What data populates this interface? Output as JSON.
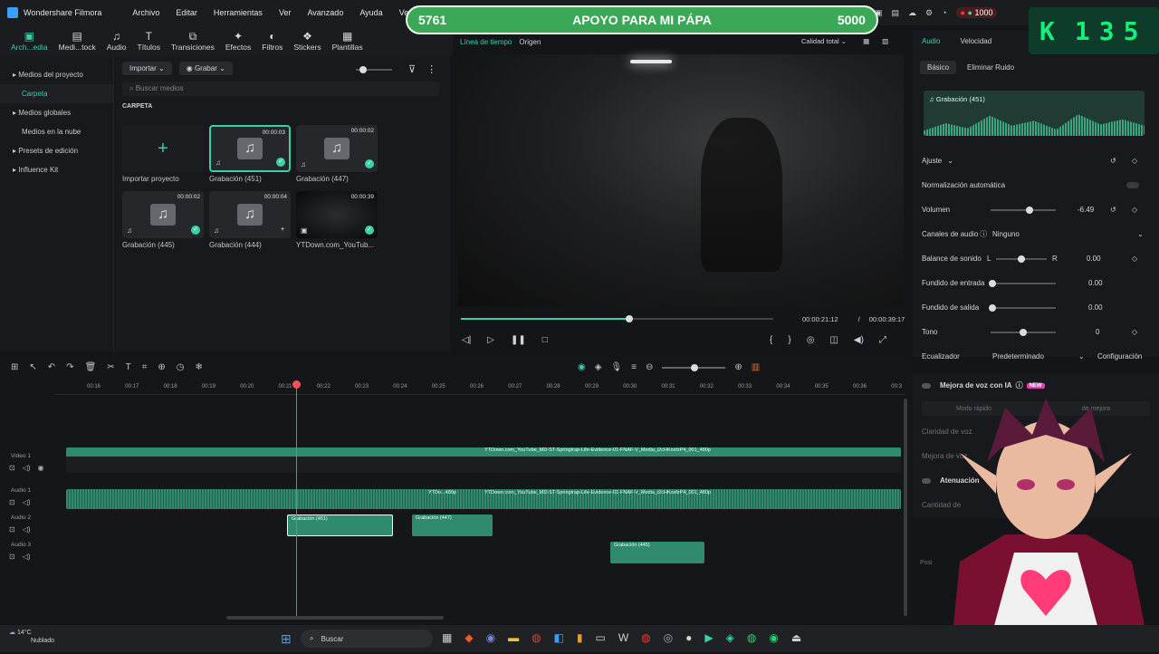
{
  "titlebar": {
    "app_name": "Wondershare Filmora",
    "menu": [
      "Archivo",
      "Editar",
      "Herramientas",
      "Ver",
      "Avanzado",
      "Ayuda",
      "Versión"
    ]
  },
  "toolbar": [
    {
      "label": "Arch...edia",
      "icon": "folder-icon",
      "active": true
    },
    {
      "label": "Medi...tock",
      "icon": "stock-icon"
    },
    {
      "label": "Audio",
      "icon": "music-icon"
    },
    {
      "label": "Títulos",
      "icon": "text-icon"
    },
    {
      "label": "Transiciones",
      "icon": "transition-icon"
    },
    {
      "label": "Efectos",
      "icon": "effects-icon"
    },
    {
      "label": "Filtros",
      "icon": "filter-icon"
    },
    {
      "label": "Stickers",
      "icon": "sticker-icon"
    },
    {
      "label": "Plantillas",
      "icon": "template-icon"
    }
  ],
  "leftnav": [
    {
      "label": "Medios del proyecto",
      "expandable": true
    },
    {
      "label": "Carpeta",
      "selected": true
    },
    {
      "label": "Medios globales",
      "expandable": true
    },
    {
      "label": "Medios en la nube"
    },
    {
      "label": "Presets de edición",
      "expandable": true
    },
    {
      "label": "Influence Kit",
      "expandable": true
    }
  ],
  "media": {
    "import_label": "Importar",
    "record_label": "Grabar",
    "search_placeholder": "Buscar medios",
    "folder_heading": "CARPETA",
    "items": [
      {
        "name": "Importar proyecto",
        "duration": "",
        "type": "import"
      },
      {
        "name": "Grabación (451)",
        "duration": "00:00:03",
        "type": "audio",
        "selected": true,
        "used": true
      },
      {
        "name": "Grabación (447)",
        "duration": "00:00:02",
        "type": "audio",
        "used": true
      },
      {
        "name": "Grabación (445)",
        "duration": "00:00:02",
        "type": "audio",
        "used": true
      },
      {
        "name": "Grabación (444)",
        "duration": "00:00:04",
        "type": "audio",
        "used": false
      },
      {
        "name": "YTDown.com_YouTub...",
        "duration": "00:00:39",
        "type": "video",
        "used": true
      }
    ]
  },
  "preview": {
    "tab_timeline": "Línea de tiempo",
    "tab_origin": "Origen",
    "quality": "Calidad total",
    "current_time": "00:00:21:12",
    "separator": "/",
    "total_time": "00:00:39:17",
    "progress": 0.54
  },
  "properties": {
    "tab_audio": "Audio",
    "tab_speed": "Velocidad",
    "sub_basic": "Básico",
    "sub_noise": "Eliminar Ruido",
    "waveform_title": "Grabación (451)",
    "adjust_label": "Ajuste",
    "auto_norm": "Normalización automática",
    "volume_label": "Volumen",
    "volume_value": "-6.49",
    "volume_level": 0.6,
    "channels_label": "Canales de audio",
    "channels_value": "Ninguno",
    "balance_label": "Balance de sonido",
    "balance_l": "L",
    "balance_r": "R",
    "balance_value": "0.00",
    "fadein_label": "Fundido de entrada",
    "fadein_value": "0.00",
    "fadeout_label": "Fundido de salida",
    "fadeout_value": "0.00",
    "tone_label": "Tono",
    "tone_value": "0",
    "eq_label": "Ecualizador",
    "eq_value": "Predeterminado",
    "eq_config": "Configuración",
    "ai_voice": "Mejora de voz con IA",
    "new_badge": "NEW",
    "fast_mode": "Modo rápido",
    "improve": "de mejora",
    "voice_clarity": "Claridad de voz",
    "voice_better": "Mejora de voz",
    "attenuation": "Atenuación",
    "quantity": "Cantidad de",
    "pos": "Posi"
  },
  "timeline": {
    "ruler": [
      "00:16",
      "00:17",
      "00:18",
      "00:19",
      "00:20",
      "00:21",
      "00:22",
      "00:23",
      "00:24",
      "00:25",
      "00:26",
      "00:27",
      "00:28",
      "00:29",
      "00:30",
      "00:31",
      "00:32",
      "00:33",
      "00:34",
      "00:35",
      "00:36",
      "00:3"
    ],
    "tracks": [
      {
        "name": "Video 1"
      },
      {
        "name": "Audio 1"
      },
      {
        "name": "Audio 2"
      },
      {
        "name": "Audio 3"
      }
    ],
    "clips": {
      "video_label": "YTDown.com_YouTube_MD-ST-Springtrap-Life-Evidence-01-FNAF-V_Media_i2cHKoxfzP4_001_480p",
      "audio1_short": "YTDo...480p",
      "audio1_long": "YTDown.com_YouTube_MD-ST-Springtrap-Life-Evidence-01-FNAF-V_Media_i2cHKoxfzP4_001_480p",
      "audio2_a": "Grabación (451)",
      "audio2_b": "Grabación (447)",
      "audio3_a": "Grabación (445)"
    }
  },
  "overlay": {
    "banner_left": "5761",
    "banner_center": "APOYO PARA MI PÁPA",
    "banner_right": "5000",
    "counter_letter": "K",
    "counter_value": "135"
  },
  "taskbar": {
    "weather_temp": "14°C",
    "weather_desc": "Nublado",
    "search_label": "Buscar",
    "recording_count": "1000"
  },
  "colors": {
    "accent": "#3ad0a8",
    "clip": "#2f8a6e",
    "banner": "#3aa856",
    "playhead": "#ff4d5a"
  }
}
